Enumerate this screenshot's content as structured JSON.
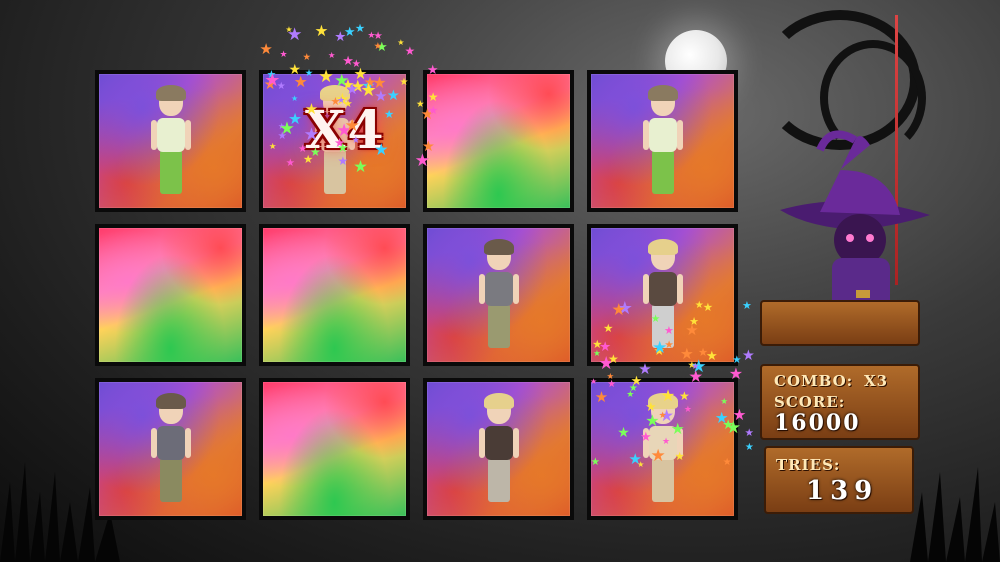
{
  "hud": {
    "multiplier_popup": "X4",
    "combo_label": "COMBO:",
    "combo_value": "X3",
    "score_label": "SCORE:",
    "score_value": "16000",
    "tries_label": "TRIES:",
    "tries_value": "139"
  },
  "board": {
    "rows": 3,
    "cols": 4,
    "cards": [
      {
        "state": "face",
        "avatar": "boy-cap-green-shorts"
      },
      {
        "state": "face",
        "avatar": "blonde-dancer"
      },
      {
        "state": "back",
        "avatar": ""
      },
      {
        "state": "face",
        "avatar": "boy-cap-green-shorts"
      },
      {
        "state": "back",
        "avatar": ""
      },
      {
        "state": "back",
        "avatar": ""
      },
      {
        "state": "face",
        "avatar": "girl-vest"
      },
      {
        "state": "face",
        "avatar": "blonde-bandana-girl"
      },
      {
        "state": "face",
        "avatar": "girl-vest-grey"
      },
      {
        "state": "back",
        "avatar": ""
      },
      {
        "state": "face",
        "avatar": "blonde-bandana-girl-2"
      },
      {
        "state": "face",
        "avatar": "blonde-dancer"
      }
    ]
  },
  "colors": {
    "witch_hat": "#6a2a9a",
    "witch_body": "#5a2a8a",
    "wood": "#9a5620"
  },
  "icons": [
    "moon-icon",
    "witch-icon",
    "stars-sparkle-icon"
  ]
}
